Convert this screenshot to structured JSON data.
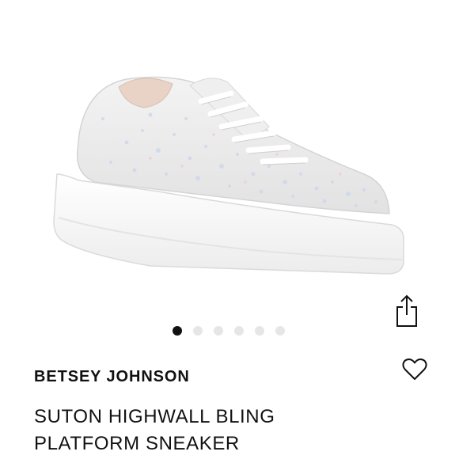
{
  "product": {
    "brand": "BETSEY JOHNSON",
    "title_line1": "SUTON HIGHWALL BLING",
    "title_line2": "PLATFORM SNEAKER",
    "image_alt": "White rhinestone-embellished platform sneaker"
  },
  "carousel": {
    "slide_count": 6,
    "active_index": 0
  },
  "icons": {
    "share": "share-icon",
    "wishlist": "heart-icon"
  },
  "colors": {
    "text": "#111111",
    "dot_active": "#111111",
    "dot_inactive": "#e6e6e6"
  }
}
